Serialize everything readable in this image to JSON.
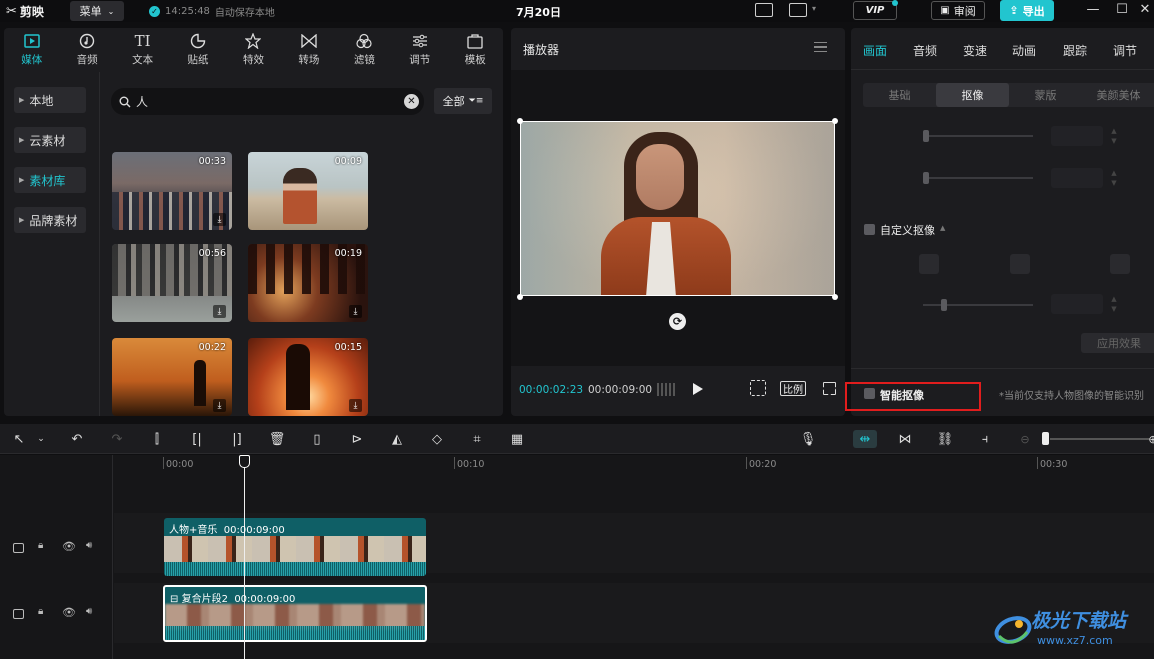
{
  "app": {
    "name": "剪映",
    "menu_label": "菜单",
    "save_time": "14:25:48",
    "save_status": "自动保存本地",
    "date": "7月20日",
    "vip_label": "VIP",
    "review_label": "审阅",
    "export_label": "导出",
    "accent_color": "#22c5cf"
  },
  "media": {
    "tabs": [
      {
        "label": "媒体",
        "icon": "media-icon"
      },
      {
        "label": "音频",
        "icon": "audio-icon"
      },
      {
        "label": "文本",
        "icon": "text-icon"
      },
      {
        "label": "贴纸",
        "icon": "sticker-icon"
      },
      {
        "label": "特效",
        "icon": "effects-icon"
      },
      {
        "label": "转场",
        "icon": "transition-icon"
      },
      {
        "label": "滤镜",
        "icon": "filter-icon"
      },
      {
        "label": "调节",
        "icon": "adjust-icon"
      },
      {
        "label": "模板",
        "icon": "template-icon"
      }
    ],
    "side_nav": [
      {
        "label": "本地"
      },
      {
        "label": "云素材"
      },
      {
        "label": "素材库"
      },
      {
        "label": "品牌素材"
      }
    ],
    "search_value": "人",
    "filter_label": "全部",
    "thumbnails": [
      {
        "duration": "00:33"
      },
      {
        "duration": "00:09"
      },
      {
        "duration": "00:56"
      },
      {
        "duration": "00:19"
      },
      {
        "duration": "00:22"
      },
      {
        "duration": "00:15"
      }
    ]
  },
  "player": {
    "title": "播放器",
    "current_time": "00:00:02:23",
    "total_time": "00:00:09:00",
    "ratio_label": "比例"
  },
  "props": {
    "tabs": [
      "画面",
      "音频",
      "变速",
      "动画",
      "跟踪",
      "调节"
    ],
    "sub_tabs": [
      "基础",
      "抠像",
      "蒙版",
      "美颜美体"
    ],
    "custom_matting_label": "自定义抠像",
    "apply_label": "应用效果",
    "smart_matting_label": "智能抠像",
    "smart_matting_note": "*当前仅支持人物图像的智能识别"
  },
  "timeline": {
    "ruler": [
      "00:00",
      "00:10",
      "00:20",
      "00:30"
    ],
    "clips": [
      {
        "title": "人物+音乐",
        "duration": "00:00:09:00"
      },
      {
        "title": "复合片段2",
        "duration": "00:00:09:00"
      }
    ]
  },
  "watermark": {
    "title": "极光下载站",
    "url": "www.xz7.com"
  }
}
